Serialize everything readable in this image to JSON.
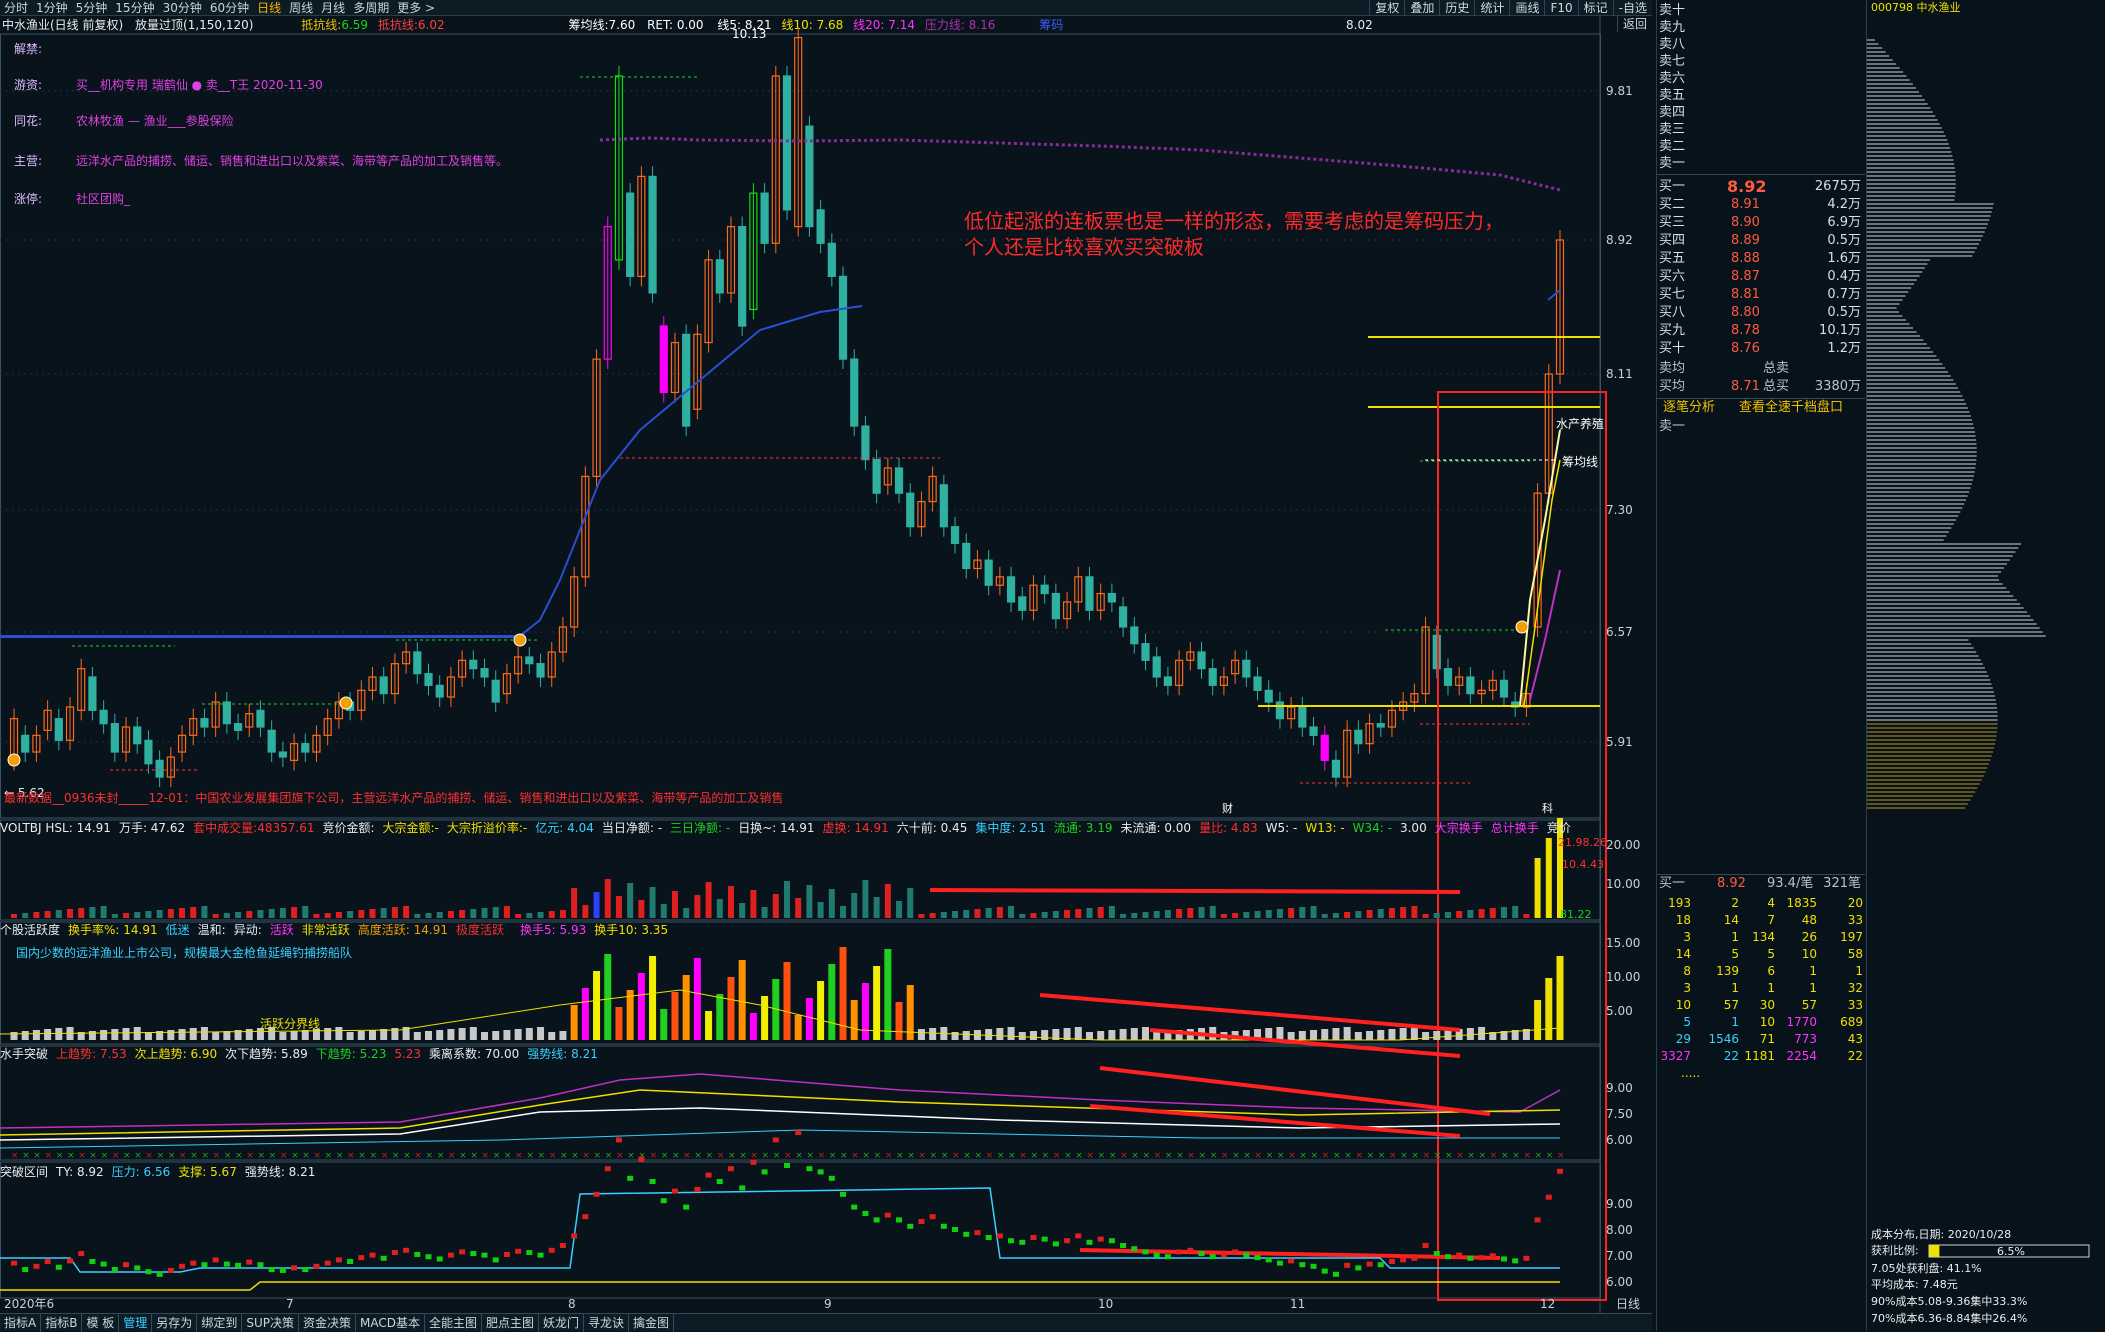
{
  "toolbar": {
    "periods": [
      "分时",
      "1分钟",
      "5分钟",
      "15分钟",
      "30分钟",
      "60分钟",
      "日线",
      "周线",
      "月线",
      "多周期",
      "更多 >"
    ],
    "selected": "日线",
    "right": [
      "复权",
      "叠加",
      "历史",
      "统计",
      "画线",
      "F10",
      "标记",
      "-自选",
      "返回"
    ]
  },
  "title": {
    "stock": "中水渔业(日线 前复权)",
    "indicator": "放量过顶(1,150,120)",
    "support_label": "抵抗线:",
    "support_val": "6.59",
    "press_label": "抵抗线:",
    "press_val": "6.02",
    "avg_label": "筹均线:",
    "avg_val": "7.60",
    "ret": "RET: 0.00",
    "l5": "线5: 8.21",
    "l10": "线10: 7.68",
    "l20": "线20: 7.14",
    "l_extra": "压力线: 8.16",
    "extra2": "筹码",
    "price_readout": "8.02"
  },
  "info": [
    {
      "k": "解禁:",
      "v": ""
    },
    {
      "k": "游资:",
      "v": "买__机构专用 瑞鹤仙 ● 卖__T王   2020-11-30"
    },
    {
      "k": "同花:",
      "v": "农林牧渔 — 渔业___参股保险"
    },
    {
      "k": "主营:",
      "v": "远洋水产品的捕捞、储运、销售和进出口以及紫菜、海带等产品的加工及销售等。"
    },
    {
      "k": "涨停:",
      "v": "社区团购_"
    }
  ],
  "annotation": [
    "低位起涨的连板票也是一样的形态，需要考虑的是筹码压力，",
    "个人还是比较喜欢买突破板"
  ],
  "main": {
    "yticks": [
      "9.81",
      "8.92",
      "8.11",
      "7.30",
      "6.57",
      "5.91"
    ],
    "high_label": "10.13",
    "low_label": "← 5.62",
    "tag_fish": "水产养殖",
    "tag_chip": "筹均线",
    "bottom_ticker": "最新数据__0936未封_____12-01：中国农业发展集团旗下公司，主营远洋水产品的捕捞、储运、销售和进出口以及紫菜、海带等产品的加工及销售",
    "tag_cai": "财",
    "tag_ke": "科"
  },
  "vol": {
    "header": [
      "VOLTBJ HSL: 14.91",
      "万手: 47.62",
      "套中成交量:48357.61",
      "竞价金额:",
      "大宗金额:-",
      "大宗折溢价率:-",
      "亿元: 4.04",
      "当日净额: -",
      "三日净额: -",
      "日换~: 14.91",
      "虚换: 14.91",
      "六十前: 0.45",
      "集中度: 2.51",
      "流通: 3.19",
      "未流通: 0.00",
      "量比: 4.83",
      "W5: -",
      "W13: -",
      "W34: -",
      "3.00",
      "大宗换手",
      "总计换手",
      "竞价"
    ],
    "yticks": [
      "20.00",
      "10.00"
    ],
    "tags": [
      "21.98.26",
      "10.4.43",
      "81.22"
    ]
  },
  "act": {
    "header": [
      "个股活跃度",
      "换手率%: 14.91",
      "低迷",
      "温和:",
      "异动:",
      "活跃",
      "非常活跃",
      "高度活跃: 14.91",
      "极度活跃",
      "",
      "换手5: 5.93",
      "换手10: 3.35"
    ],
    "note": "国内少数的远洋渔业上市公司，规模最大金枪鱼延绳钓捕捞船队",
    "line_label": "活跃分界线",
    "yticks": [
      "15.00",
      "10.00",
      "5.00"
    ]
  },
  "water": {
    "header": [
      "水手突破",
      "上趋势: 7.53",
      "次上趋势: 6.90",
      "次下趋势: 5.89",
      "下趋势: 5.23",
      "5.23",
      "乘离系数: 70.00",
      "强势线: 8.21"
    ],
    "yticks": [
      "9.00",
      "7.50",
      "6.00"
    ]
  },
  "break": {
    "header": [
      "突破区间",
      "TY: 8.92",
      "压力: 6.56",
      "支撑: 5.67",
      "强势线: 8.21"
    ],
    "yticks": [
      "9.00",
      "8.00",
      "7.00",
      "6.00"
    ]
  },
  "dates": [
    "2020年6",
    "7",
    "8",
    "9",
    "10",
    "11",
    "12",
    "日线"
  ],
  "bottom": [
    "指标A",
    "指标B",
    "模 板",
    "管理",
    "另存为",
    "绑定到",
    "SUP决策",
    "资金决策",
    "MACD基本",
    "全能主图",
    "肥点主图",
    "妖龙门",
    "寻龙诀",
    "擒金图"
  ],
  "book": {
    "asks": [
      {
        "l": "卖十",
        "p": "",
        "v": ""
      },
      {
        "l": "卖九",
        "p": "",
        "v": ""
      },
      {
        "l": "卖八",
        "p": "",
        "v": ""
      },
      {
        "l": "卖七",
        "p": "",
        "v": ""
      },
      {
        "l": "卖六",
        "p": "",
        "v": ""
      },
      {
        "l": "卖五",
        "p": "",
        "v": ""
      },
      {
        "l": "卖四",
        "p": "",
        "v": ""
      },
      {
        "l": "卖三",
        "p": "",
        "v": ""
      },
      {
        "l": "卖二",
        "p": "",
        "v": ""
      },
      {
        "l": "卖一",
        "p": "",
        "v": ""
      }
    ],
    "bids": [
      {
        "l": "买一",
        "p": "8.92",
        "v": "2675万"
      },
      {
        "l": "买二",
        "p": "8.91",
        "v": "4.2万"
      },
      {
        "l": "买三",
        "p": "8.90",
        "v": "6.9万"
      },
      {
        "l": "买四",
        "p": "8.89",
        "v": "0.5万"
      },
      {
        "l": "买五",
        "p": "8.88",
        "v": "1.6万"
      },
      {
        "l": "买六",
        "p": "8.87",
        "v": "0.4万"
      },
      {
        "l": "买七",
        "p": "8.81",
        "v": "0.7万"
      },
      {
        "l": "买八",
        "p": "8.80",
        "v": "0.5万"
      },
      {
        "l": "买九",
        "p": "8.78",
        "v": "10.1万"
      },
      {
        "l": "买十",
        "p": "8.76",
        "v": "1.2万"
      }
    ],
    "avg_sell": "卖均",
    "total_sell": "总卖",
    "avg_buy": "买均",
    "avg_buy_p": "8.71",
    "total_buy": "总买",
    "total_buy_v": "3380万",
    "link1": "逐笔分析",
    "link2": "查看全速千档盘口",
    "sell1": "卖一",
    "bid1_label": "买一",
    "bid1_p": "8.92",
    "bid1_v": "93.4/笔",
    "bid1_n": "321笔",
    "queue": [
      [
        "193",
        "2",
        "4",
        "1835",
        "20"
      ],
      [
        "18",
        "14",
        "7",
        "48",
        "33"
      ],
      [
        "3",
        "1",
        "134",
        "26",
        "197"
      ],
      [
        "14",
        "5",
        "5",
        "10",
        "58"
      ],
      [
        "8",
        "139",
        "6",
        "1",
        "1"
      ],
      [
        "3",
        "1",
        "1",
        "1",
        "32"
      ],
      [
        "10",
        "57",
        "30",
        "57",
        "33"
      ],
      [
        "5",
        "1",
        "10",
        "1770",
        "689"
      ],
      [
        "29",
        "1546",
        "71",
        "773",
        "43"
      ],
      [
        "3327",
        "22",
        "1181",
        "2254",
        "22"
      ]
    ],
    "more": "....."
  },
  "cost": {
    "ticker": "000798 中水渔业",
    "title": "成本分布,日期: 2020/10/28",
    "ratio_label": "获利比例:",
    "ratio": "6.5%",
    "l1": "7.05处获利盘: 41.1%",
    "l2": "平均成本: 7.48元",
    "l3": "90%成本5.08-9.36集中33.3%",
    "l4": "70%成本6.36-8.84集中26.4%"
  }
}
